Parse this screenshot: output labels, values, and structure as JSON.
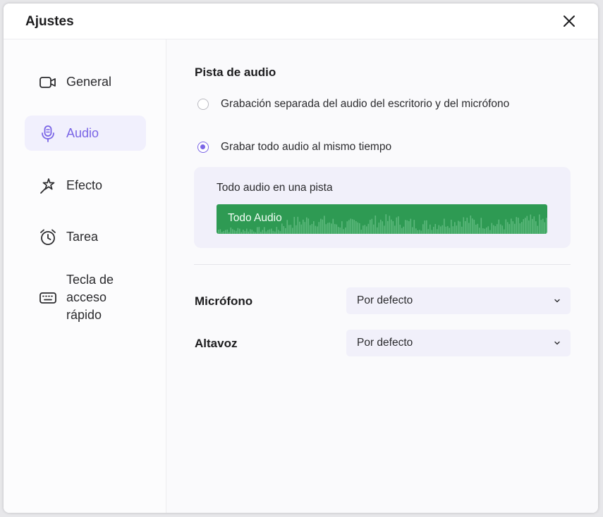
{
  "dialog": {
    "title": "Ajustes",
    "close_icon": "close-icon"
  },
  "sidebar": {
    "items": [
      {
        "label": "General",
        "icon": "camera-icon",
        "active": false
      },
      {
        "label": "Audio",
        "icon": "microphone-icon",
        "active": true
      },
      {
        "label": "Efecto",
        "icon": "magic-wand-icon",
        "active": false
      },
      {
        "label": "Tarea",
        "icon": "alarm-clock-icon",
        "active": false
      },
      {
        "label": "Tecla de acceso rápido",
        "label_lines": [
          "Tecla de",
          "acceso",
          "rápido"
        ],
        "icon": "keyboard-icon",
        "active": false
      }
    ]
  },
  "audio": {
    "section_title": "Pista de audio",
    "options": [
      {
        "label": "Grabación separada del audio del escritorio y del micrófono",
        "checked": false
      },
      {
        "label": "Grabar todo audio al mismo tiempo",
        "checked": true
      }
    ],
    "track_caption": "Todo audio en una pista",
    "track_label": "Todo Audio",
    "microphone": {
      "label": "Micrófono",
      "value": "Por defecto"
    },
    "speaker": {
      "label": "Altavoz",
      "value": "Por defecto"
    }
  },
  "colors": {
    "accent": "#7a65e6",
    "track_green": "#2e9a53",
    "active_bg": "#f1f0fd"
  }
}
